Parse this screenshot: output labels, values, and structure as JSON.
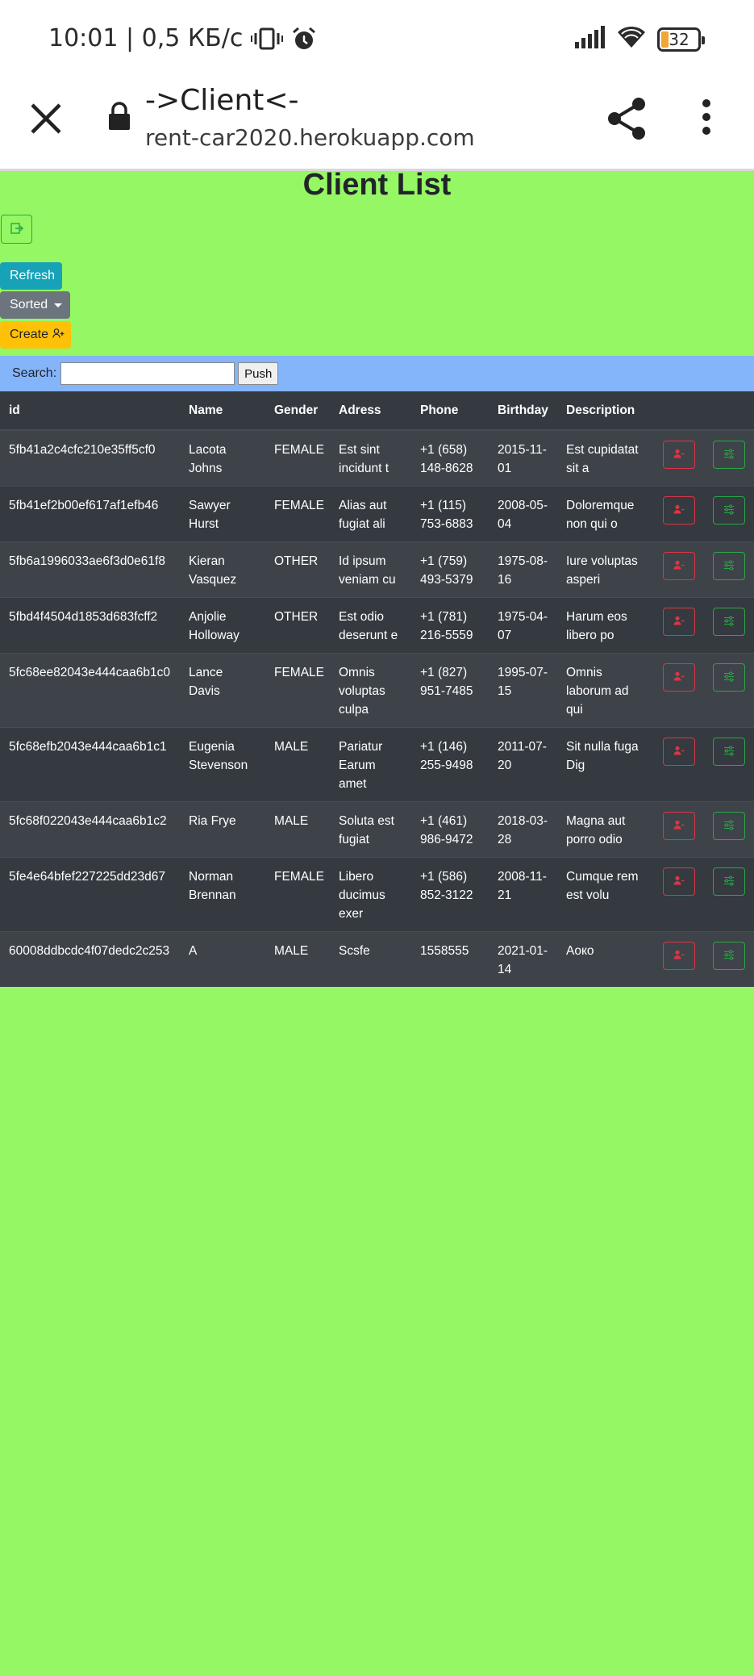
{
  "status_bar": {
    "time_speed": "10:01 | 0,5 КБ/с",
    "battery": "32"
  },
  "browser": {
    "title": "->Client<-",
    "url": "rent-car2020.herokuapp.com"
  },
  "page": {
    "title": "Client List",
    "refresh_label": "Refresh",
    "sorted_label": "Sorted",
    "create_label": "Create"
  },
  "search": {
    "label": "Search:",
    "value": "",
    "push_label": "Push"
  },
  "colors": {
    "page_background": "#95f763",
    "search_bar": "#84b4fa",
    "table_dark": "#343a40",
    "refresh": "#17a2b8",
    "sorted": "#6c757d",
    "create": "#ffc107",
    "danger": "#dc3545",
    "success": "#28a745"
  },
  "table": {
    "headers": [
      "id",
      "Name",
      "Gender",
      "Adress",
      "Phone",
      "Birthday",
      "Description"
    ],
    "rows": [
      {
        "id": "5fb41a2c4cfc210e35ff5cf0",
        "name": "Lacota Johns",
        "gender": "FEMALE",
        "adress": "Est sint incidunt t",
        "phone": "+1 (658) 148-8628",
        "birthday": "2015-11-01",
        "description": "Est cupidatat sit a"
      },
      {
        "id": "5fb41ef2b00ef617af1efb46",
        "name": "Sawyer Hurst",
        "gender": "FEMALE",
        "adress": "Alias aut fugiat ali",
        "phone": "+1 (115) 753-6883",
        "birthday": "2008-05-04",
        "description": "Doloremque non qui o"
      },
      {
        "id": "5fb6a1996033ae6f3d0e61f8",
        "name": "Kieran Vasquez",
        "gender": "OTHER",
        "adress": "Id ipsum veniam cu",
        "phone": "+1 (759) 493-5379",
        "birthday": "1975-08-16",
        "description": "Iure voluptas asperi"
      },
      {
        "id": "5fbd4f4504d1853d683fcff2",
        "name": "Anjolie Holloway",
        "gender": "OTHER",
        "adress": "Est odio deserunt e",
        "phone": "+1 (781) 216-5559",
        "birthday": "1975-04-07",
        "description": "Harum eos libero po"
      },
      {
        "id": "5fc68ee82043e444caa6b1c0",
        "name": "Lance Davis",
        "gender": "FEMALE",
        "adress": "Omnis voluptas culpa",
        "phone": "+1 (827) 951-7485",
        "birthday": "1995-07-15",
        "description": "Omnis laborum ad qui"
      },
      {
        "id": "5fc68efb2043e444caa6b1c1",
        "name": "Eugenia Stevenson",
        "gender": "MALE",
        "adress": "Pariatur Earum amet",
        "phone": "+1 (146) 255-9498",
        "birthday": "2011-07-20",
        "description": "Sit nulla fuga Dig"
      },
      {
        "id": "5fc68f022043e444caa6b1c2",
        "name": "Ria Frye",
        "gender": "MALE",
        "adress": "Soluta est fugiat",
        "phone": "+1 (461) 986-9472",
        "birthday": "2018-03-28",
        "description": "Magna aut porro odio"
      },
      {
        "id": "5fe4e64bfef227225dd23d67",
        "name": "Norman Brennan",
        "gender": "FEMALE",
        "adress": "Libero ducimus exer",
        "phone": "+1 (586) 852-3122",
        "birthday": "2008-11-21",
        "description": "Cumque rem est volu"
      },
      {
        "id": "60008ddbcdc4f07dedc2c253",
        "name": "A",
        "gender": "MALE",
        "adress": "Scsfe",
        "phone": "1558555",
        "birthday": "2021-01-14",
        "description": "Аоко"
      }
    ]
  }
}
